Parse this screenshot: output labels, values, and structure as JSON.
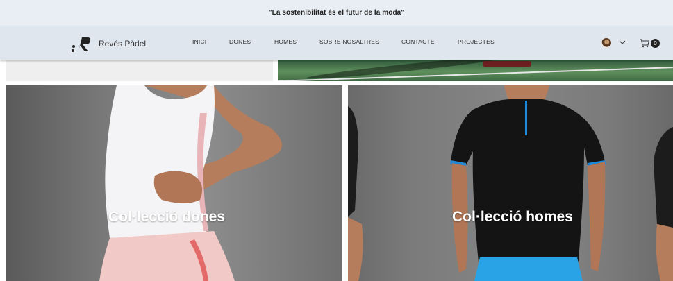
{
  "announcement": "\"La sostenibilitat és el futur de la moda\"",
  "brand": {
    "name": "Revés Pàdel",
    "logo_glyph": ".R"
  },
  "nav": [
    "INICI",
    "DONES",
    "HOMES",
    "SOBRE NOSALTRES",
    "CONTACTE",
    "PROJECTES"
  ],
  "account": {
    "icon": "user-avatar",
    "menu_icon": "chevron-down-icon"
  },
  "cart": {
    "icon": "cart-icon",
    "count": "0"
  },
  "collections": {
    "women_label": "Col·lecció dones",
    "men_label": "Col·lecció homes"
  },
  "colors": {
    "announcement_bg": "#e9eef4",
    "header_bg": "#dfe6ee",
    "text": "#333333"
  }
}
